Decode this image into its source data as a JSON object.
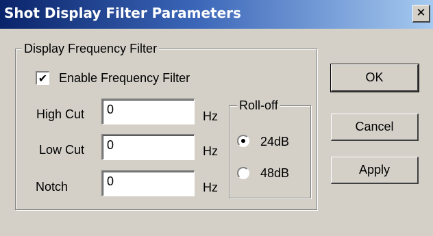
{
  "window": {
    "title": "Shot Display Filter Parameters",
    "close_glyph": "✕",
    "close_icon": "close-icon"
  },
  "frequency_group": {
    "label": "Display Frequency Filter",
    "enable_checkbox": {
      "label": "Enable Frequency Filter",
      "checked": true,
      "check_glyph": "✔"
    },
    "fields": [
      {
        "label": "High Cut",
        "value": "0",
        "unit": "Hz"
      },
      {
        "label": "Low Cut",
        "value": "0",
        "unit": "Hz"
      },
      {
        "label": "Notch",
        "value": "0",
        "unit": "Hz"
      }
    ]
  },
  "rolloff_group": {
    "label": "Roll-off",
    "options": [
      {
        "label": "24dB",
        "selected": true
      },
      {
        "label": "48dB",
        "selected": false
      }
    ]
  },
  "buttons": {
    "ok": "OK",
    "cancel": "Cancel",
    "apply": "Apply"
  }
}
